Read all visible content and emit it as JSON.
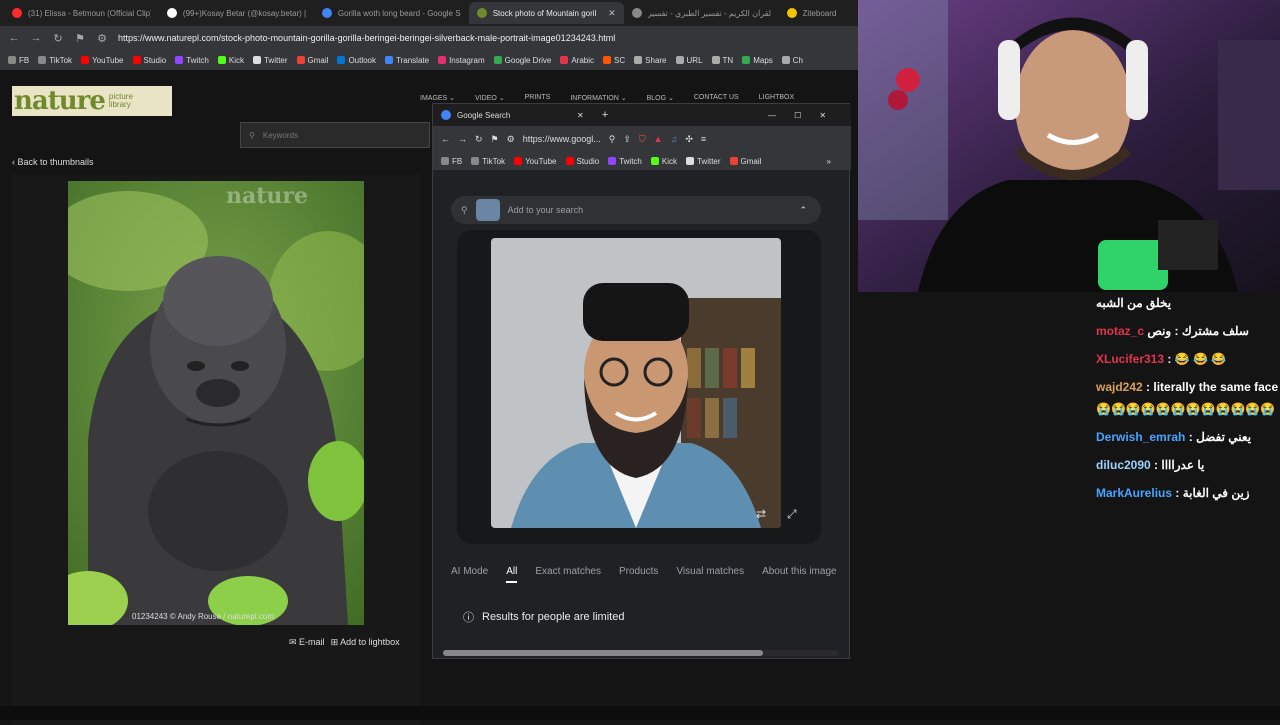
{
  "browser": {
    "tabs": [
      {
        "label": "(31) Elissa - Betmoun (Official Clip) / ...",
        "color": "#ff2b2b",
        "active": false
      },
      {
        "label": "(99+)Kosay Betar (@kosay.betar) | Ti...",
        "color": "#ffffff",
        "active": false
      },
      {
        "label": "Gorilla woth long beard - Google Se...",
        "color": "#4285f4",
        "active": false
      },
      {
        "label": "Stock photo of Mountain gorilla ...",
        "color": "#6f8a2b",
        "active": true
      },
      {
        "label": "القرآن الكريم - تفسير الطبري - تفسير ...",
        "color": "#888888",
        "active": false
      },
      {
        "label": "Ziteboard",
        "color": "#f5c400",
        "active": false
      }
    ],
    "url": "https://www.naturepl.com/stock-photo-mountain-gorilla-gorilla-beringei-beringei-silverback-male-portrait-image01234243.html",
    "bookmarks": [
      "FB",
      "TikTok",
      "YouTube",
      "Studio",
      "Twitch",
      "Kick",
      "Twitter",
      "Gmail",
      "Outlook",
      "Translate",
      "Instagram",
      "Google Drive",
      "Arabic",
      "SC",
      "Share",
      "URL",
      "TN",
      "Maps",
      "Ch"
    ]
  },
  "site": {
    "logo_main": "nature",
    "logo_sub1": "picture",
    "logo_sub2": "library",
    "nav": [
      "IMAGES ⌄",
      "VIDEO ⌄",
      "PRINTS",
      "INFORMATION ⌄",
      "BLOG ⌄",
      "CONTACT US",
      "LIGHTBOX"
    ],
    "search_placeholder": "Keywords",
    "back_label": "Back to thumbnails",
    "watermark": "nature",
    "caption": "01234243 © Andy Rouse / naturepl.com",
    "email_label": "E-mail",
    "lightbox_label": "Add to lightbox"
  },
  "popup": {
    "title": "Google Search",
    "url": "https://www.googl...",
    "bookmarks": [
      "FB",
      "TikTok",
      "YouTube",
      "Studio",
      "Twitch",
      "Kick",
      "Twitter",
      "Gmail"
    ],
    "search_placeholder": "Add to your search",
    "tabs": [
      "AI Mode",
      "All",
      "Exact matches",
      "Products",
      "Visual matches",
      "About this image"
    ],
    "notice": "Results for people are limited"
  },
  "chat": [
    {
      "user": "",
      "color": "#ffffff",
      "text": "يخلق من الشبه"
    },
    {
      "user": "motaz_c",
      "color": "#e0354b",
      "text": "سلف مشترك : ونص"
    },
    {
      "user": "XLucifer313",
      "color": "#e0354b",
      "text": ": 😂 😂 😂"
    },
    {
      "user": "wajd242",
      "color": "#d9a05b",
      "text": ": literally the same face 😭😭😭😭😭😭😭😭😭😭😭😭"
    },
    {
      "user": "Derwish_emrah",
      "color": "#4aa3ff",
      "text": ": يعني تفضل"
    },
    {
      "user": "diluc2090",
      "color": "#9fd3ff",
      "text": ": يا عدراااا"
    },
    {
      "user": "MarkAurelius",
      "color": "#4aa3ff",
      "text": ": زين في الغابة"
    }
  ]
}
